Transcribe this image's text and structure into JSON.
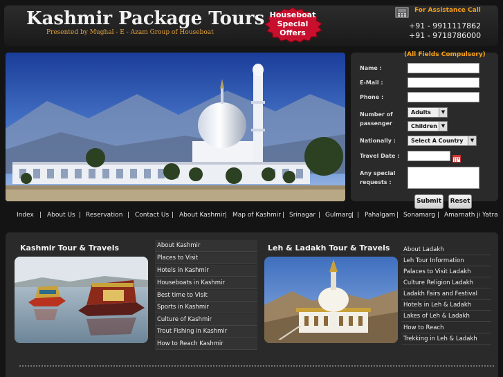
{
  "header": {
    "title": "Kashmir Package Tours",
    "tagline": "Presented by Mughal - E - Azam Group of Houseboat",
    "offer_lines": [
      "Houseboat",
      "Special",
      "Offers"
    ],
    "assistance_label": "For Assistance Call",
    "phones": [
      "+91 - 9911117862",
      "+91 - 9718786000"
    ]
  },
  "form": {
    "note": "(All Fields Compulsory)",
    "name_label": "Name :",
    "email_label": "E-Mail :",
    "phone_label": "Phone :",
    "passenger_label_1": "Number of",
    "passenger_label_2": "passenger",
    "adults_select": "Adults",
    "children_select": "Children",
    "nationality_label": "Nationally :",
    "country_select": "Select A Country",
    "travel_date_label": "Travel Date :",
    "special_label_1": "Any special",
    "special_label_2": "requests :",
    "submit_label": "Submit",
    "reset_label": "Reset"
  },
  "nav": {
    "items": [
      "Index",
      "About Us",
      "Reservation",
      "Contact Us",
      "About Kashmir",
      "Map of Kashmir",
      "Srinagar",
      "Gulmarg",
      "Pahalgam",
      "Sonamarg",
      "Amarnath ji Yatra"
    ],
    "separator": "|"
  },
  "kashmir": {
    "title": "Kashmir Tour & Travels",
    "links": [
      "About Kashmir",
      "Places to Visit",
      "Hotels in Kashmir",
      "Houseboats in Kashmir",
      "Best time to Visit",
      "Sports in Kashmir",
      "Culture of Kashmir",
      "Trout Fishing in Kashmir",
      "How to Reach Kashmir"
    ]
  },
  "ladakh": {
    "title": "Leh & Ladakh Tour & Travels",
    "links": [
      "About Ladakh",
      "Leh Tour Information",
      "Palaces to Visit Ladakh",
      "Culture Religion Ladakh",
      "Ladakh Fairs and Festival",
      "Hotels in Leh & Ladakh",
      "Lakes of Leh & Ladakh",
      "How to Reach",
      "Trekking in Leh & Ladakh"
    ]
  },
  "colors": {
    "accent": "#f5a01a",
    "offer_red": "#c8102e",
    "panel": "#2a2a2a",
    "background": "#141414"
  }
}
